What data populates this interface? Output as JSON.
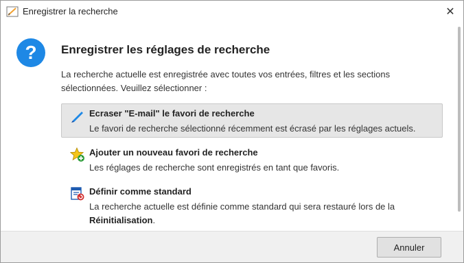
{
  "window": {
    "title": "Enregistrer la recherche",
    "close_glyph": "✕",
    "icon": "app-document-icon"
  },
  "dialog": {
    "icon": "question-icon",
    "heading": "Enregistrer les réglages de recherche",
    "description": "La recherche actuelle est enregistrée avec toutes vos entrées, filtres et les sections sélectionnées. Veuillez sélectionner :",
    "options": [
      {
        "icon": "pencil-icon",
        "title": "Ecraser \"E-mail\" le favori de recherche",
        "subtitle": "Le favori de recherche sélectionné récemment est écrasé par les réglages actuels.",
        "selected": true
      },
      {
        "icon": "star-add-icon",
        "title": "Ajouter un nouveau favori de recherche",
        "subtitle": "Les réglages de recherche sont enregistrés en tant que favoris.",
        "selected": false
      },
      {
        "icon": "document-reset-icon",
        "title": "Définir comme standard",
        "subtitle_main": "La recherche actuelle est définie comme standard qui sera restauré lors de la",
        "subtitle_bold": "Réinitialisation",
        "subtitle_end": ".",
        "selected": false
      }
    ]
  },
  "footer": {
    "cancel_label": "Annuler"
  },
  "colors": {
    "accent": "#1e88e5",
    "selected_bg": "#e6e6e6"
  }
}
